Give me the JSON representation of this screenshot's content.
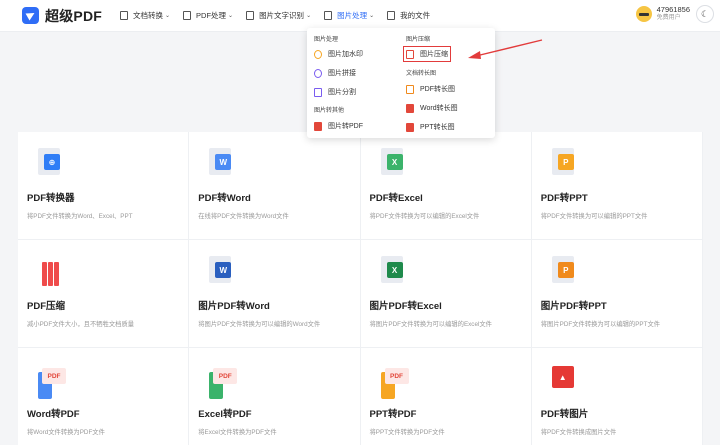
{
  "app": {
    "title": "超级PDF"
  },
  "nav": [
    {
      "label": "文档转换",
      "chevron": "⌄"
    },
    {
      "label": "PDF处理",
      "chevron": "⌄"
    },
    {
      "label": "图片文字识别",
      "chevron": "⌄"
    },
    {
      "label": "图片处理",
      "chevron": "⌄"
    },
    {
      "label": "我的文件",
      "chevron": ""
    }
  ],
  "user": {
    "id": "47961856",
    "role": "免费用户"
  },
  "theme_icon": "☾",
  "dropdown": {
    "left_head1": "图片处理",
    "left_items": [
      "图片加水印",
      "图片拼接",
      "图片分割"
    ],
    "left_head2": "图片转其他",
    "left_items2": [
      "图片转PDF"
    ],
    "right_head1": "图片压缩",
    "right_items": [
      "图片压缩"
    ],
    "right_head2": "文档转长图",
    "right_items2": [
      "PDF转长图",
      "Word转长图",
      "PPT转长图"
    ]
  },
  "cards": [
    {
      "title": "PDF转换器",
      "desc": "将PDF文件转换为Word、Excel、PPT",
      "badge": "⊕",
      "color": "#2f7df6"
    },
    {
      "title": "PDF转Word",
      "desc": "在线将PDF文件转换为Word文件",
      "badge": "W",
      "color": "#4a8af4"
    },
    {
      "title": "PDF转Excel",
      "desc": "将PDF文件转换为可以编辑的Excel文件",
      "badge": "X",
      "color": "#3bb36b"
    },
    {
      "title": "PDF转PPT",
      "desc": "将PDF文件转换为可以编辑的PPT文件",
      "badge": "P",
      "color": "#f6a623"
    },
    {
      "title": "PDF压缩",
      "desc": "减小PDF文件大小，且不牺牲文档质量",
      "badge": "",
      "color": "#ef4b4b"
    },
    {
      "title": "图片PDF转Word",
      "desc": "将图片PDF文件转换为可以编辑的Word文件",
      "badge": "W",
      "color": "#2a5fbf"
    },
    {
      "title": "图片PDF转Excel",
      "desc": "将图片PDF文件转换为可以编辑的Excel文件",
      "badge": "X",
      "color": "#1f8a4c"
    },
    {
      "title": "图片PDF转PPT",
      "desc": "将图片PDF文件转换为可以编辑的PPT文件",
      "badge": "P",
      "color": "#f08a1c"
    },
    {
      "title": "Word转PDF",
      "desc": "将Word文件转换为PDF文件",
      "badge": "PDF",
      "color": "#4a8af4"
    },
    {
      "title": "Excel转PDF",
      "desc": "将Excel文件转换为PDF文件",
      "badge": "PDF",
      "color": "#3bb36b"
    },
    {
      "title": "PPT转PDF",
      "desc": "将PPT文件转换为PDF文件",
      "badge": "PDF",
      "color": "#f6a623"
    },
    {
      "title": "PDF转图片",
      "desc": "将PDF文件转换成图片文件",
      "badge": "▲",
      "color": "#e53935"
    }
  ]
}
